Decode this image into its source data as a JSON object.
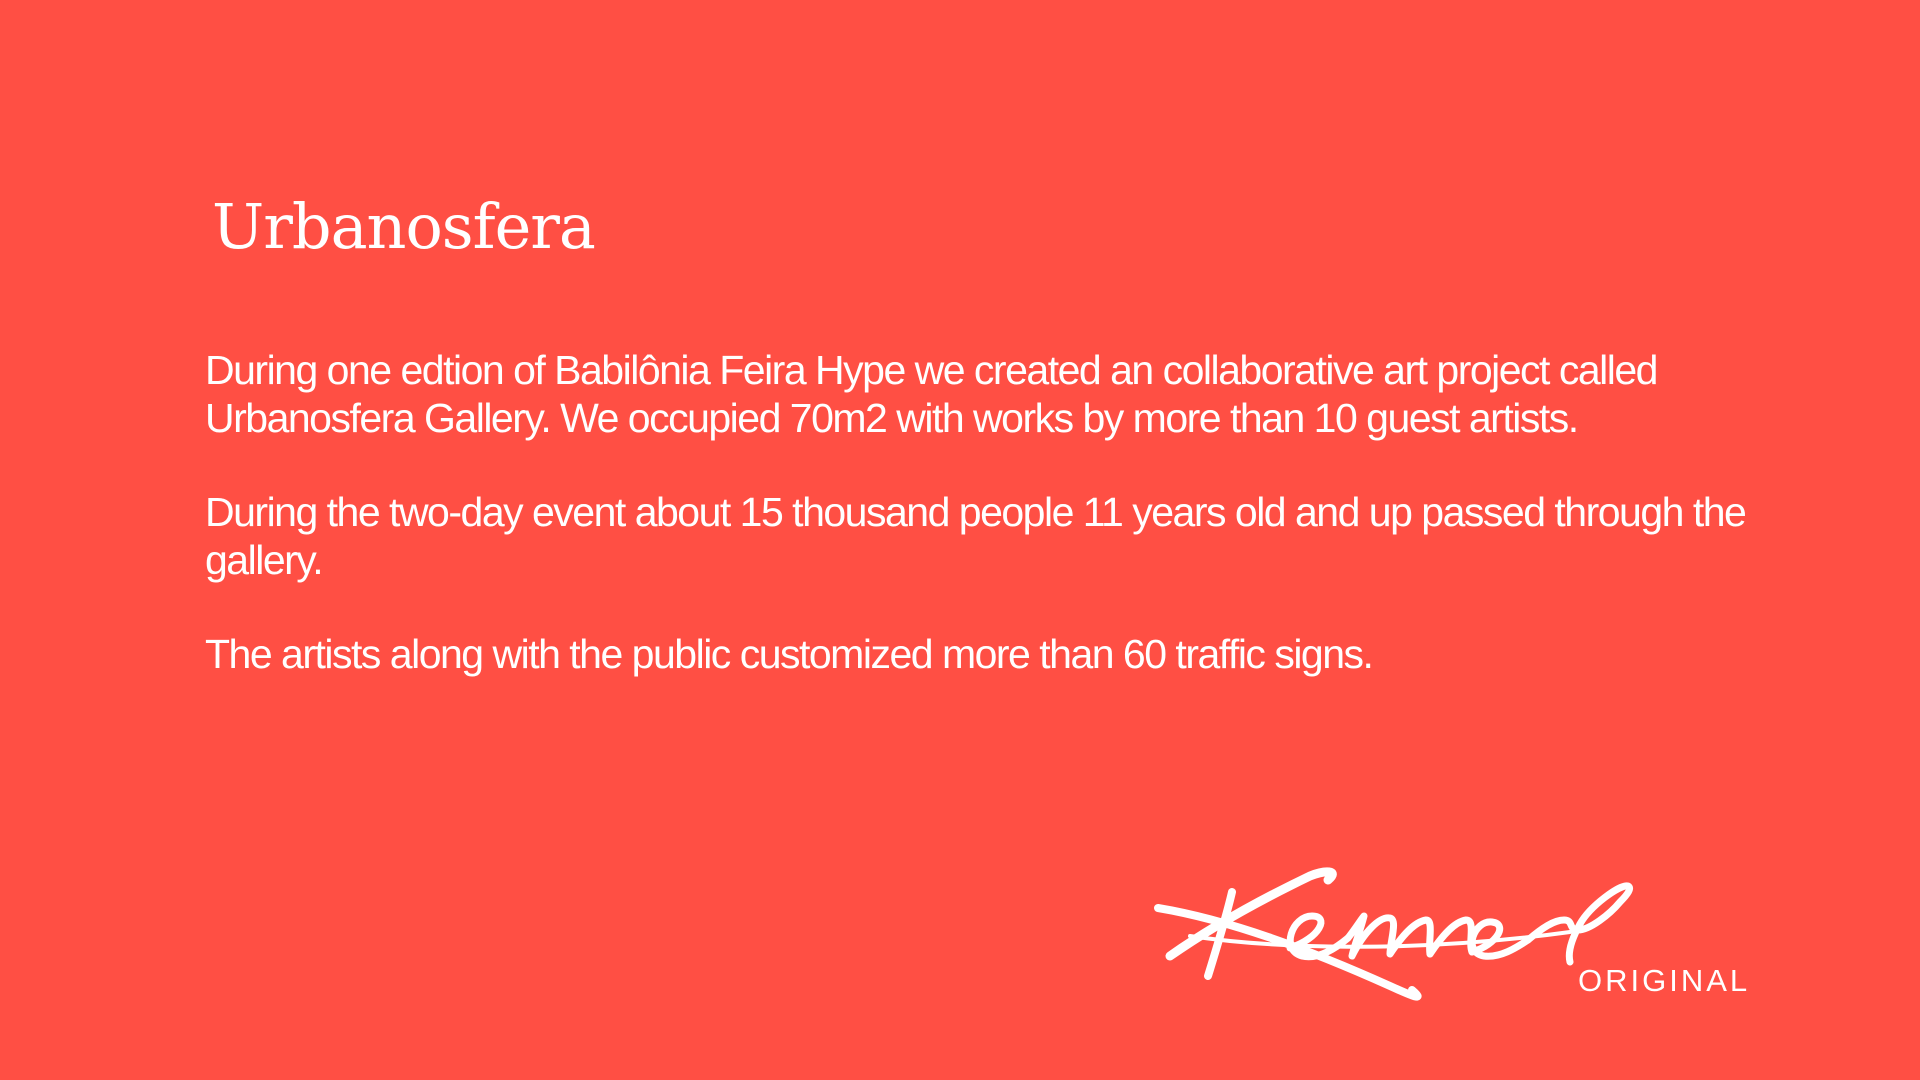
{
  "slide": {
    "title": "Urbanosfera",
    "paragraphs": [
      "During one edtion of Babilônia Feira Hype we created an collaborative art project called Urbanosfera Gallery. We occupied 70m2 with works by more than 10 guest artists.",
      "During the two-day event about 15 thousand people 11 years old and up passed through the gallery.",
      "The artists along with the public customized more than 60 traffic signs."
    ]
  },
  "brand": {
    "logo_script": "Kenner",
    "logo_sub": "ORIGINAL"
  },
  "colors": {
    "background": "#ff4f44",
    "text": "#ffffff"
  }
}
